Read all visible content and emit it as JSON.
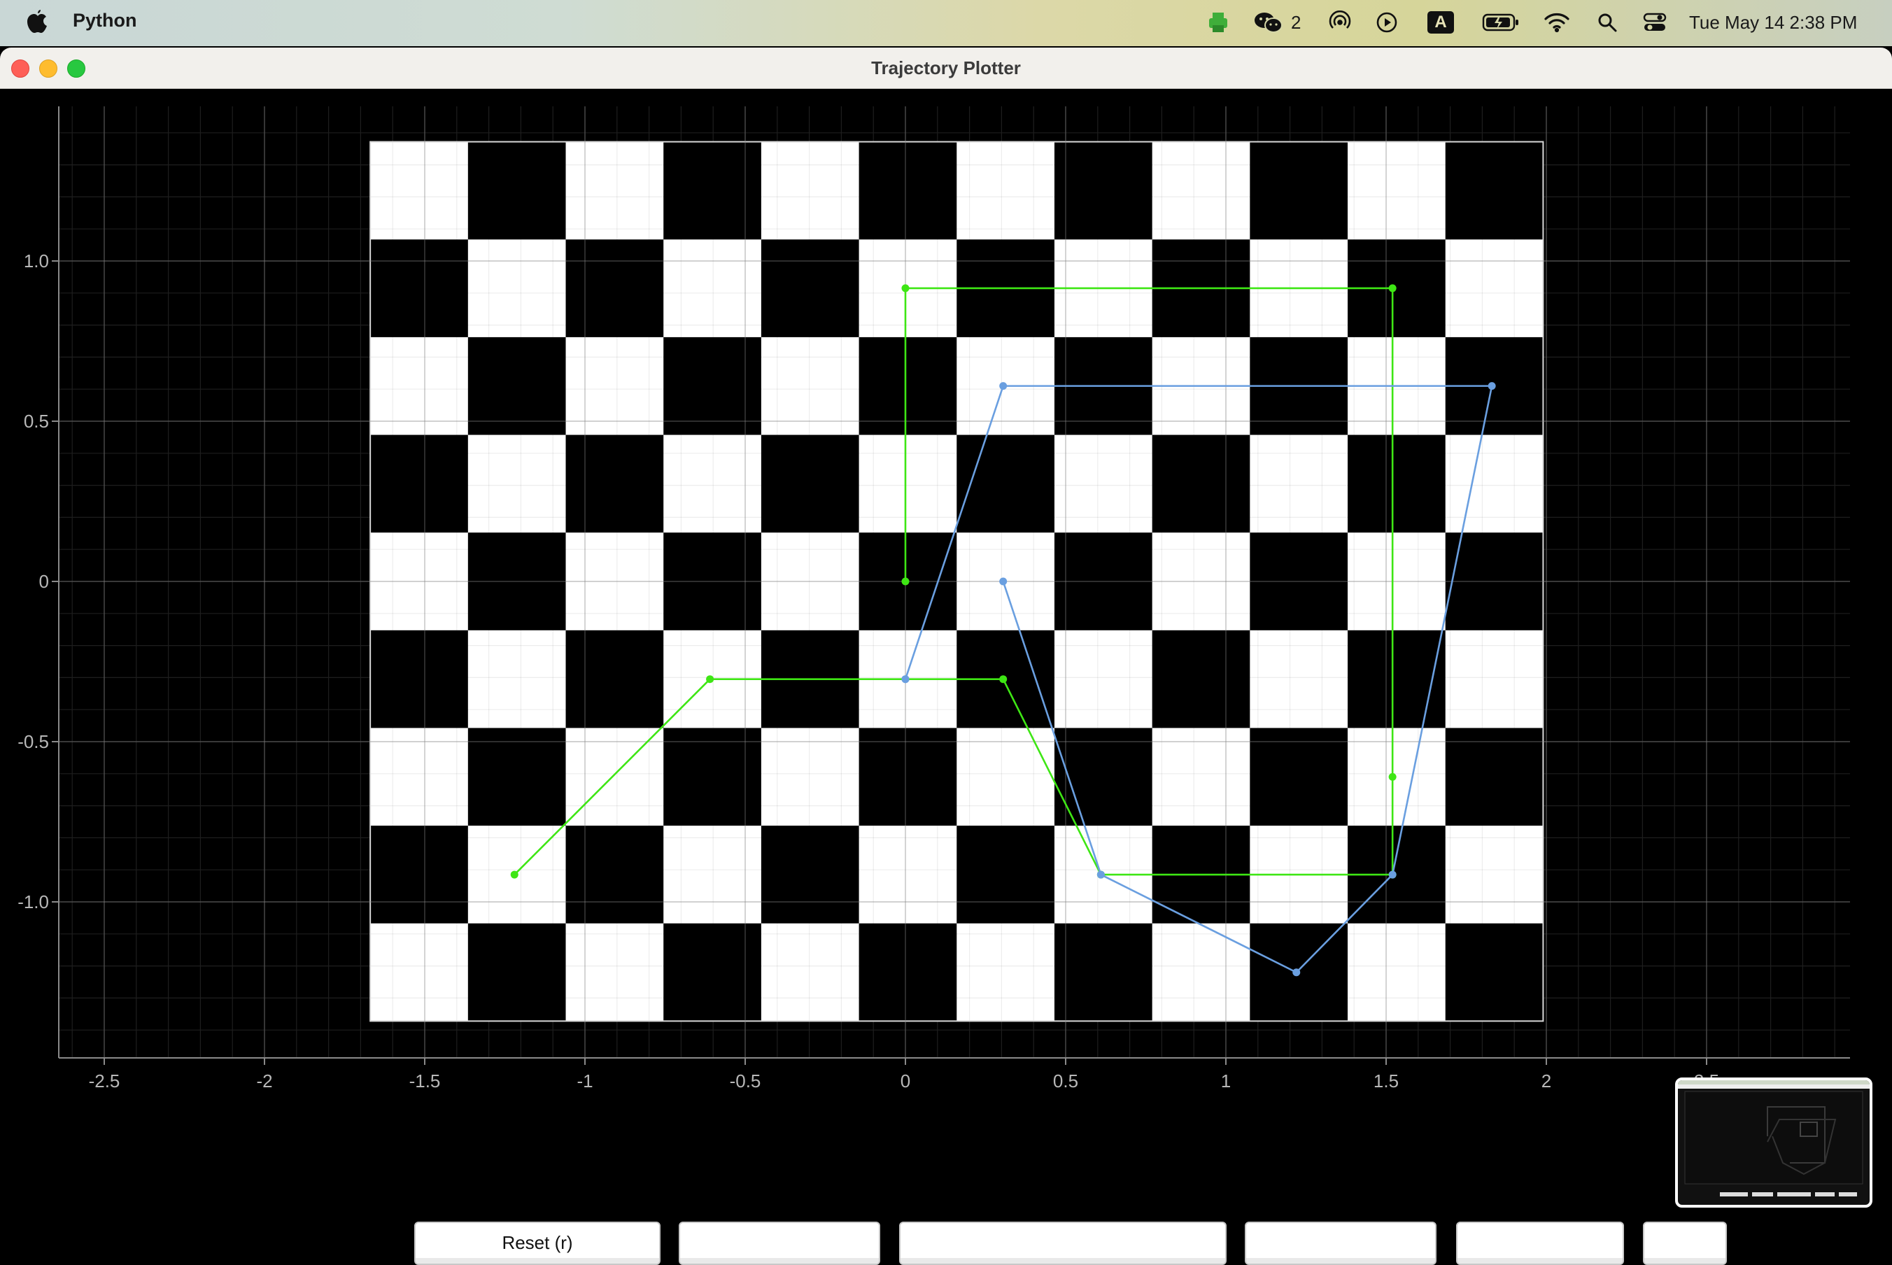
{
  "menubar": {
    "app_name": "Python",
    "wechat_count": "2",
    "keyboard_input": "A",
    "datetime": "Tue May 14  2:38 PM",
    "icons": [
      "apple-icon",
      "printer-icon",
      "wechat-icon",
      "airdrop-icon",
      "play-icon",
      "input-source-icon",
      "battery-icon",
      "wifi-icon",
      "search-icon",
      "control-center-icon"
    ]
  },
  "window": {
    "title": "Trajectory Plotter"
  },
  "buttons": [
    {
      "label": "Reset (r)"
    },
    {
      "label": ""
    },
    {
      "label": ""
    },
    {
      "label": ""
    },
    {
      "label": ""
    },
    {
      "label": ""
    }
  ],
  "colors": {
    "green_trajectory": "#3ee614",
    "blue_trajectory": "#6a9fe0",
    "board_dark": "#000000",
    "board_light": "#ffffff"
  },
  "chart_data": {
    "type": "line",
    "title": "",
    "xlabel": "",
    "ylabel": "",
    "xlim": [
      -2.65,
      2.95
    ],
    "ylim": [
      -1.48,
      1.48
    ],
    "x_ticks": [
      -2.5,
      -2,
      -1.5,
      -1,
      -0.5,
      0,
      0.5,
      1,
      1.5,
      2,
      2.5
    ],
    "x_tick_labels": [
      "-2.5",
      "-2",
      "-1.5",
      "-1",
      "-0.5",
      "0",
      "0.5",
      "1",
      "1.5",
      "2",
      "2.5"
    ],
    "y_ticks": [
      1.0,
      0.5,
      0,
      -0.5,
      -1.0
    ],
    "y_tick_labels": [
      "1.0",
      "0.5",
      "0",
      "-0.5",
      "-1.0"
    ],
    "grid": true,
    "checkerboard": {
      "x_range": [
        -1.67,
        1.99
      ],
      "y_range": [
        -1.372,
        1.372
      ],
      "cols": 12,
      "rows": 9,
      "top_left": "light"
    },
    "series": [
      {
        "color": "#3ee614",
        "x": [
          0,
          0,
          1.52,
          1.52,
          1.52,
          0.61,
          0.305,
          -0.61,
          -1.22
        ],
        "y": [
          0,
          0.915,
          0.915,
          -0.61,
          -0.915,
          -0.915,
          -0.305,
          -0.305,
          -0.915
        ]
      },
      {
        "color": "#6a9fe0",
        "x": [
          0.305,
          0.61,
          1.22,
          1.52,
          1.83,
          0.305,
          0,
          0
        ],
        "y": [
          0,
          -0.915,
          -1.22,
          -0.915,
          0.61,
          0.61,
          -0.305,
          -0.305
        ]
      }
    ]
  }
}
